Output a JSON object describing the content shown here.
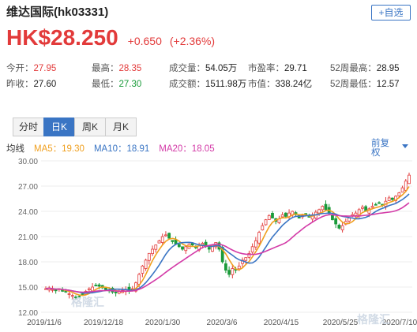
{
  "header": {
    "title": "维达国际(hk03331)",
    "add_button": "+自选"
  },
  "quote": {
    "price": "HK$28.250",
    "change": "+0.650",
    "change_pct": "(+2.36%)"
  },
  "stats": {
    "row1": [
      {
        "label": "今开：",
        "value": "27.95",
        "tone": "red"
      },
      {
        "label": "最高：",
        "value": "28.35",
        "tone": "red"
      },
      {
        "label": "成交量：",
        "value": "54.05万",
        "tone": ""
      },
      {
        "label": "市盈率：",
        "value": "29.71",
        "tone": ""
      },
      {
        "label": "52周最高：",
        "value": "28.95",
        "tone": ""
      }
    ],
    "row2": [
      {
        "label": "昨收：",
        "value": "27.60",
        "tone": ""
      },
      {
        "label": "最低：",
        "value": "27.30",
        "tone": "green"
      },
      {
        "label": "成交额：",
        "value": "1511.98万",
        "tone": ""
      },
      {
        "label": "市值：",
        "value": "338.24亿",
        "tone": ""
      },
      {
        "label": "52周最低：",
        "value": "12.57",
        "tone": ""
      }
    ]
  },
  "tabs": [
    "分时",
    "日K",
    "周K",
    "月K"
  ],
  "active_tab": 1,
  "legend": {
    "title": "均线",
    "ma5": "MA5：19.30",
    "ma10": "MA10：18.91",
    "ma20": "MA20：18.05"
  },
  "adjust": {
    "label_line1": "前复",
    "label_line2": "权"
  },
  "watermarks": [
    "格隆汇",
    "格隆汇"
  ],
  "colors": {
    "up": "#e23a3a",
    "down": "#1a9b3a",
    "accent": "#3a75c4",
    "ma5": "#f0a020",
    "ma10": "#3a75c4",
    "ma20": "#d33aa7"
  },
  "chart_data": {
    "type": "candlestick",
    "ylim": [
      12.0,
      30.0
    ],
    "y_ticks": [
      "30.00",
      "27.00",
      "24.00",
      "21.00",
      "18.00",
      "15.00",
      "12.00"
    ],
    "x_ticks": [
      "2019/11/6",
      "2019/12/18",
      "2020/1/30",
      "2020/3/6",
      "2020/4/15",
      "2020/5/25",
      "2020/7/10"
    ],
    "close_trend": [
      14.8,
      14.9,
      14.7,
      14.6,
      14.8,
      14.5,
      14.4,
      14.2,
      14.0,
      13.8,
      13.9,
      14.1,
      14.5,
      14.8,
      15.0,
      15.2,
      15.1,
      14.9,
      14.7,
      14.6,
      14.4,
      14.3,
      14.5,
      14.6,
      14.7,
      14.6,
      14.8,
      15.5,
      16.5,
      17.5,
      18.2,
      19.0,
      19.5,
      20.0,
      20.5,
      21.0,
      21.2,
      20.8,
      20.4,
      20.1,
      19.8,
      19.5,
      19.8,
      20.1,
      20.0,
      19.7,
      19.9,
      20.2,
      19.8,
      19.5,
      19.9,
      20.3,
      19.5,
      18.0,
      17.0,
      16.5,
      17.2,
      17.0,
      17.5,
      18.2,
      18.5,
      19.0,
      19.8,
      20.5,
      21.5,
      22.3,
      23.0,
      23.5,
      23.2,
      22.8,
      23.1,
      23.6,
      23.4,
      23.8,
      24.0,
      23.6,
      23.2,
      23.5,
      23.7,
      23.3,
      23.5,
      23.9,
      24.2,
      24.6,
      24.2,
      23.8,
      23.0,
      22.5,
      22.0,
      22.3,
      22.8,
      23.2,
      23.6,
      23.8,
      24.2,
      24.5,
      24.0,
      24.3,
      24.6,
      24.8,
      25.0,
      24.7,
      25.2,
      25.6,
      25.4,
      25.8,
      26.2,
      26.8,
      27.6,
      28.3
    ]
  }
}
